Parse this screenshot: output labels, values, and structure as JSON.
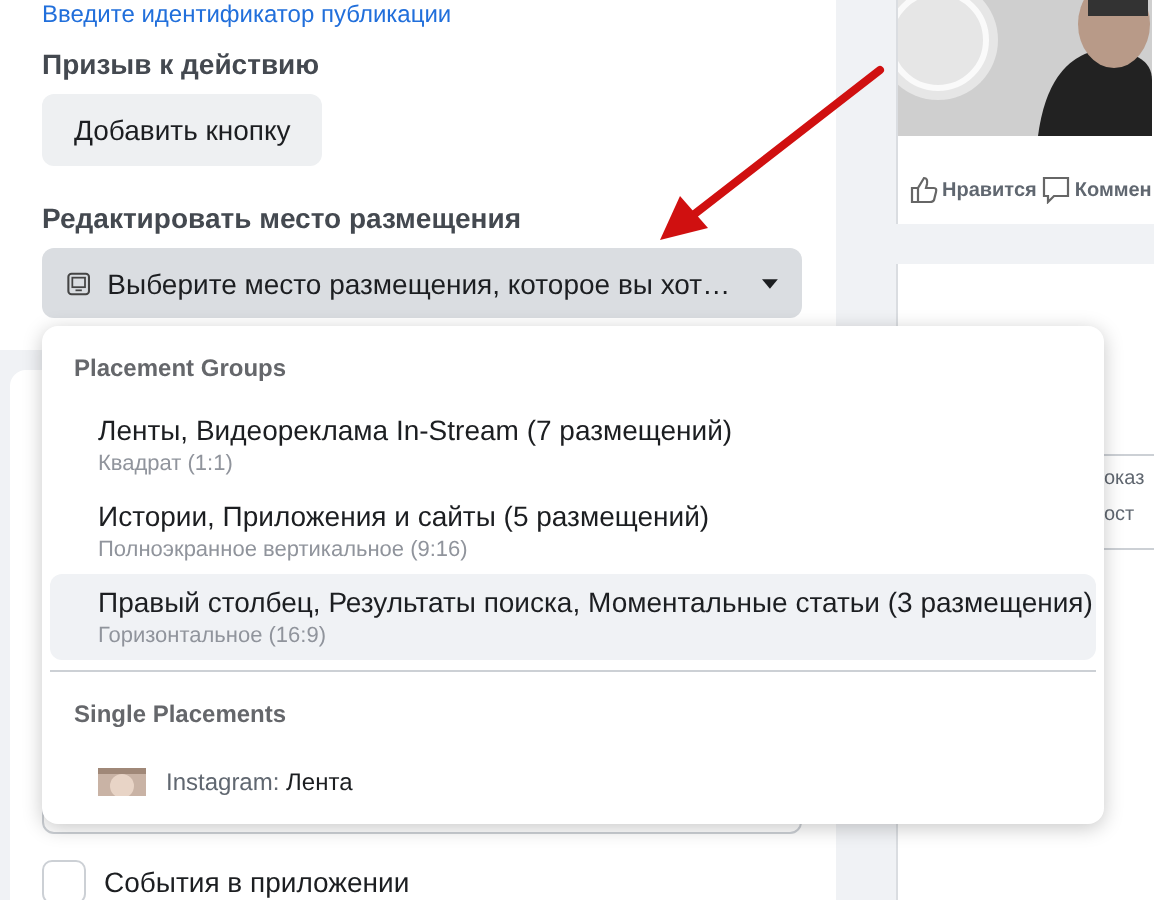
{
  "top_link": "Введите идентификатор публикации",
  "cta": {
    "label": "Призыв к действию",
    "button": "Добавить кнопку"
  },
  "placement": {
    "label": "Редактировать место размещения",
    "value": "Выберите место размещения, которое вы хот…"
  },
  "menu": {
    "sections": [
      {
        "title": "Placement Groups",
        "items": [
          {
            "kind": "group",
            "title": "Ленты, Видеореклама In-Stream (7 размещений)",
            "subtitle": "Квадрат (1:1)",
            "selected": false
          },
          {
            "kind": "group",
            "title": "Истории, Приложения и сайты (5 размещений)",
            "subtitle": "Полноэкранное вертикальное (9:16)",
            "selected": false
          },
          {
            "kind": "group",
            "title": "Правый столбец, Результаты поиска, Моментальные статьи (3 размещения)",
            "subtitle": "Горизонтальное (16:9)",
            "selected": true
          }
        ]
      },
      {
        "title": "Single Placements",
        "items": [
          {
            "kind": "single",
            "platform": "Instagram:",
            "title": "Лента",
            "selected": false
          }
        ]
      }
    ]
  },
  "preview": {
    "actions": [
      "Нравится",
      "Коммен"
    ]
  },
  "side_text": [
    "оказ",
    "ост"
  ],
  "checkbox": {
    "label": "События в приложении",
    "checked": false
  }
}
